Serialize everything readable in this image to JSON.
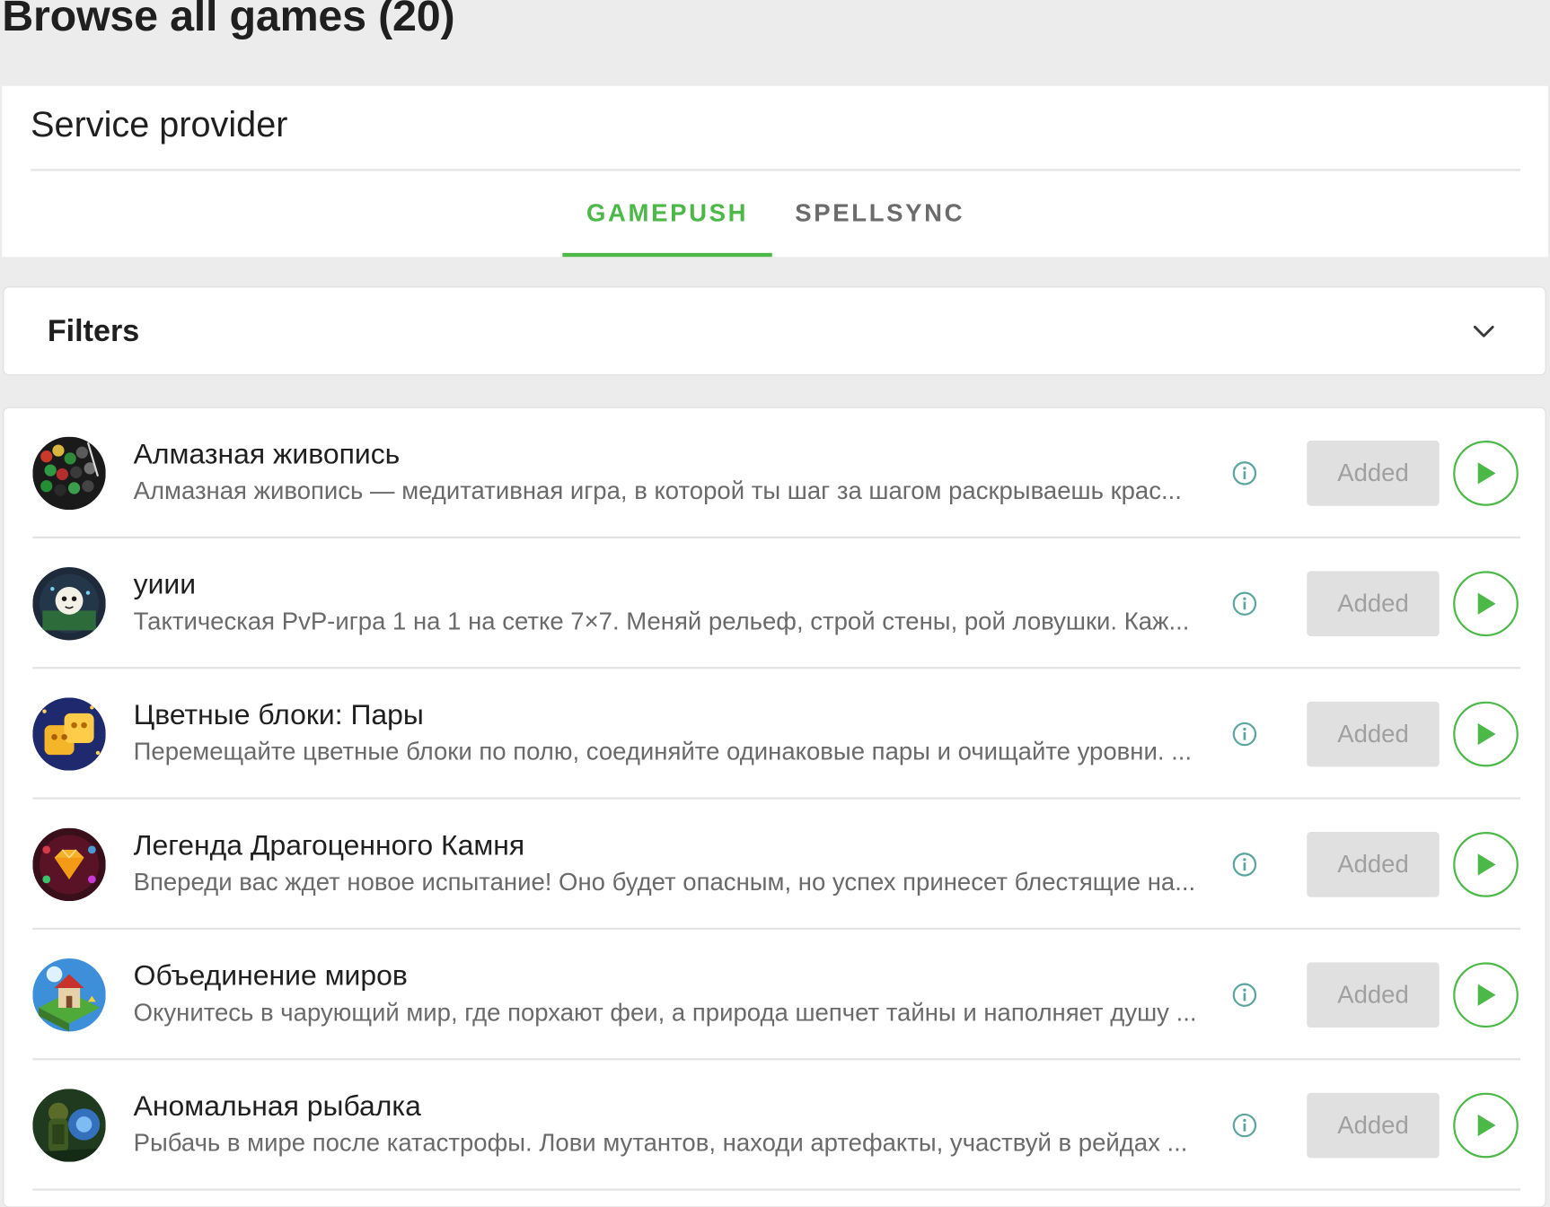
{
  "page": {
    "title": "Browse all games (20)"
  },
  "provider": {
    "title": "Service provider",
    "tabs": [
      {
        "label": "GAMEPUSH",
        "active": true
      },
      {
        "label": "SPELLSYNC",
        "active": false
      }
    ]
  },
  "filters": {
    "label": "Filters",
    "icon": "chevron-down-icon"
  },
  "colors": {
    "accent": "#4cb848",
    "page_background": "#ececec",
    "added_button_bg": "#e0e0e0",
    "info_icon": "#5aa59d"
  },
  "games": [
    {
      "name": "Алмазная живопись",
      "description": "Алмазная живопись — медитативная игра, в которой ты шаг за шагом раскрываешь крас...",
      "status": "Added"
    },
    {
      "name": "уиии",
      "description": "Тактическая PvP-игра 1 на 1 на сетке 7×7. Меняй рельеф, строй стены, рой ловушки. Каж...",
      "status": "Added"
    },
    {
      "name": "Цветные блоки: Пары",
      "description": "Перемещайте цветные блоки по полю, соединяйте одинаковые пары и очищайте уровни. ...",
      "status": "Added"
    },
    {
      "name": "Легенда Драгоценного Камня",
      "description": "Впереди вас ждет новое испытание! Оно будет опасным, но успех принесет блестящие на...",
      "status": "Added"
    },
    {
      "name": "Объединение миров",
      "description": "Окунитесь в чарующий мир, где порхают феи, а природа шепчет тайны и наполняет душу ...",
      "status": "Added"
    },
    {
      "name": "Аномальная рыбалка",
      "description": "Рыбачь в мире после катастрофы. Лови мутантов, находи артефакты, участвуй в рейдах ...",
      "status": "Added"
    }
  ]
}
